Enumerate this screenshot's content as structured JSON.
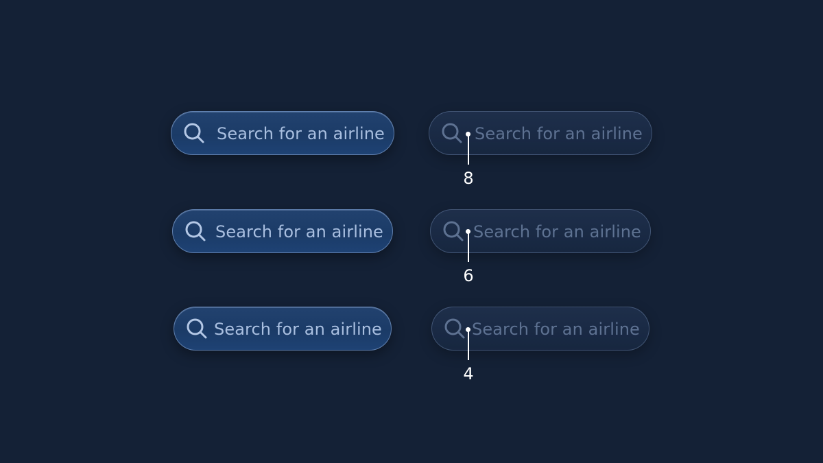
{
  "search_fields": [
    {
      "placeholder": "Search for an airline",
      "style": "filled",
      "icon": "search-icon"
    },
    {
      "placeholder": "Search for an airline",
      "style": "ghost",
      "icon": "search-icon"
    },
    {
      "placeholder": "Search for an airline",
      "style": "filled",
      "icon": "search-icon"
    },
    {
      "placeholder": "Search for an airline",
      "style": "ghost",
      "icon": "search-icon"
    },
    {
      "placeholder": "Search for an airline",
      "style": "filled",
      "icon": "search-icon"
    },
    {
      "placeholder": "Search for an airline",
      "style": "ghost",
      "icon": "search-icon"
    }
  ],
  "spacing_annotations": [
    "8",
    "6",
    "4"
  ],
  "colors": {
    "background": "#142136",
    "filled_field": "#1f3f6e",
    "placeholder_text": "#a9bfe0",
    "annotation": "#ffffff"
  }
}
